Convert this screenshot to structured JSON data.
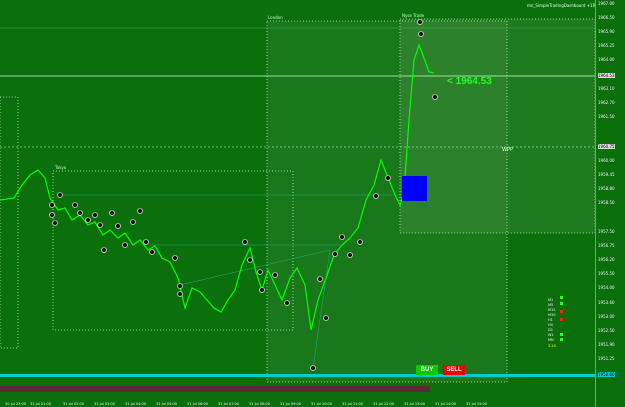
{
  "window": {
    "title": "mn_SimpleTradingDashboard +1R"
  },
  "boxes": {
    "london": "London",
    "newyork": "Nyse Trade",
    "tokyo": "Tokyo"
  },
  "current_price": "<  1964.53",
  "tick_marker": "WPP",
  "buttons": {
    "buy": "BUY",
    "sell": "SELL"
  },
  "price_axis": [
    "1967.00",
    "1966.50",
    "1965.90",
    "1965.25",
    "1964.00",
    "1963.10",
    "1962.70",
    "1961.50",
    "1960.75",
    "1960.00",
    "1959.45",
    "1958.80",
    "1958.50",
    "1957.50",
    "1956.75",
    "1956.20",
    "1955.50",
    "1954.00",
    "1953.60",
    "1953.00",
    "1952.50",
    "1951.90",
    "1951.25",
    "1950.60"
  ],
  "price_axis_markers": {
    "top": "1964.53",
    "mid": "1960.75",
    "bottom": "1950.60"
  },
  "time_axis": [
    "30 Jul 23:00",
    "31 Jul 01:00",
    "31 Jul 02:00",
    "31 Jul 03:00",
    "31 Jul 04:00",
    "31 Jul 05:00",
    "31 Jul 06:00",
    "31 Jul 07:00",
    "31 Jul 08:00",
    "31 Jul 09:00",
    "31 Jul 10:00",
    "31 Jul 11:00",
    "31 Jul 12:00",
    "31 Jul 13:00",
    "31 Jul 14:00",
    "31 Jul 15:00"
  ],
  "indicators": [
    "M1",
    "M5",
    "M15",
    "M30",
    "H1",
    "H4",
    "D1",
    "W1",
    "MN",
    "3.20"
  ],
  "colors": {
    "background": "#0b700b",
    "price_line": "#00ff00",
    "buy": "#00cc00",
    "sell": "#ee0000",
    "blue_box": "#0000ff",
    "bottom_bar": "#00cccc"
  }
}
